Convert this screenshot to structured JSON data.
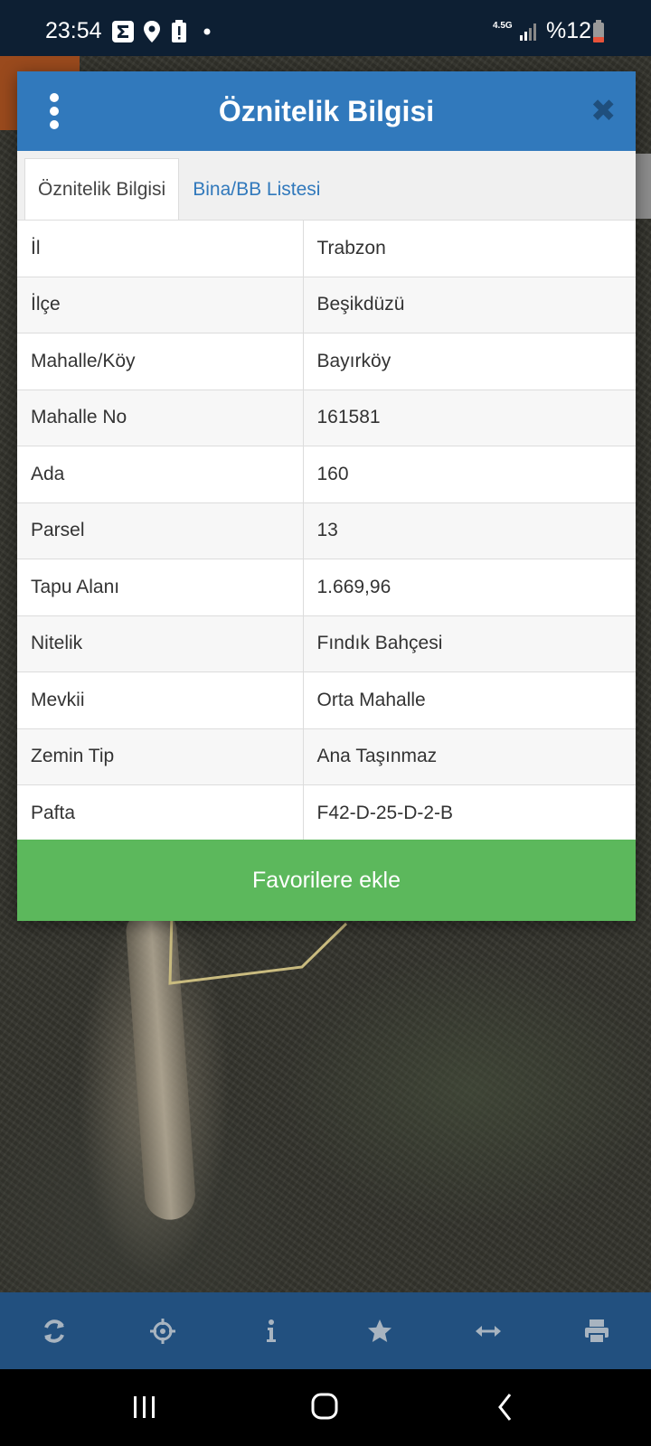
{
  "status_bar": {
    "time": "23:54",
    "network": "4.5G",
    "battery": "%12",
    "icons": [
      "sigma-icon",
      "location-icon",
      "battery-alert-icon",
      "dot-icon",
      "signal-icon",
      "battery-icon"
    ]
  },
  "modal": {
    "title": "Öznitelik Bilgisi",
    "tabs": [
      {
        "label": "Öznitelik Bilgisi",
        "active": true
      },
      {
        "label": "Bina/BB Listesi",
        "active": false
      }
    ],
    "rows": [
      {
        "key": "İl",
        "value": "Trabzon"
      },
      {
        "key": "İlçe",
        "value": "Beşikdüzü"
      },
      {
        "key": "Mahalle/Köy",
        "value": "Bayırköy"
      },
      {
        "key": "Mahalle No",
        "value": "161581"
      },
      {
        "key": "Ada",
        "value": "160"
      },
      {
        "key": "Parsel",
        "value": "13"
      },
      {
        "key": "Tapu Alanı",
        "value": "1.669,96"
      },
      {
        "key": "Nitelik",
        "value": "Fındık Bahçesi"
      },
      {
        "key": "Mevkii",
        "value": "Orta Mahalle"
      },
      {
        "key": "Zemin Tip",
        "value": "Ana Taşınmaz"
      },
      {
        "key": "Pafta",
        "value": "F42-D-25-D-2-B"
      }
    ],
    "favorite_button": "Favorilere ekle"
  },
  "toolbar": {
    "icons": [
      "refresh-icon",
      "crosshair-icon",
      "info-icon",
      "star-icon",
      "measure-icon",
      "print-icon"
    ]
  },
  "colors": {
    "header": "#3179bc",
    "toolbar": "#22507f",
    "favorite": "#5cb85c",
    "status_bar": "#0d1f33"
  }
}
